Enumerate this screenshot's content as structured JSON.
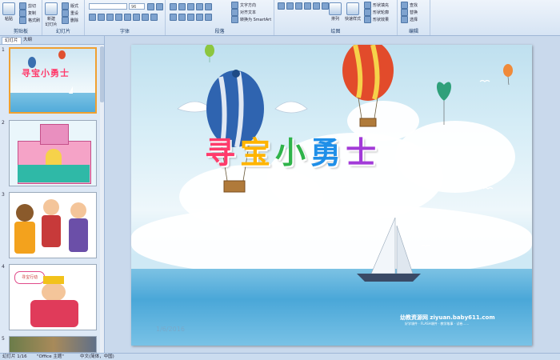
{
  "ribbon": {
    "clipboard": {
      "paste": "粘贴",
      "cut": "剪切",
      "copy": "复制",
      "format_painter": "格式刷",
      "label": "剪贴板"
    },
    "slides": {
      "new_slide": "新建\n幻灯片",
      "layout": "版式",
      "reset": "重设",
      "delete": "删除",
      "label": "幻灯片"
    },
    "font": {
      "size": "96",
      "label": "字体"
    },
    "paragraph": {
      "text_direction": "文字方向",
      "align_text": "对齐文本",
      "smartart": "转换为 SmartArt",
      "label": "段落"
    },
    "drawing": {
      "arrange": "排列",
      "quick_styles": "快速样式",
      "shape_fill": "形状填充",
      "shape_outline": "形状轮廓",
      "shape_effects": "形状效果",
      "label": "绘图"
    },
    "editing": {
      "find": "查找",
      "replace": "替换",
      "select": "选择",
      "label": "编辑"
    }
  },
  "panel": {
    "tabs": [
      "幻灯片",
      "大纲"
    ],
    "thumbs": [
      {
        "num": "1",
        "caption": "寻宝小勇士"
      },
      {
        "num": "2",
        "caption": ""
      },
      {
        "num": "3",
        "caption": ""
      },
      {
        "num": "4",
        "caption": "寻宝行动"
      },
      {
        "num": "5",
        "caption": ""
      }
    ]
  },
  "slide": {
    "title_chars": [
      "寻",
      "宝",
      "小",
      "勇",
      "士"
    ],
    "title_colors": [
      "#ff3b6b",
      "#ffb400",
      "#2fb34a",
      "#1f8fe8",
      "#a23bd8"
    ],
    "date": "1/6/2016",
    "watermark": "幼教资源网 ziyuan.baby611.com",
    "watermark_sub": "好学课件 · FLASH课件 · 教学故事 · 试卷……"
  },
  "status": {
    "slide_info": "幻灯片 1/16",
    "theme": "\"Office 主题\"",
    "language": "中文(简体，中国)"
  }
}
